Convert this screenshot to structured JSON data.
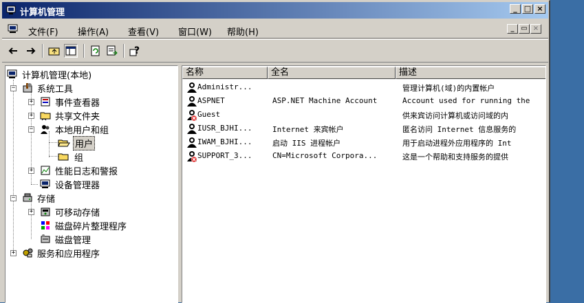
{
  "window": {
    "title": "计算机管理",
    "controls": [
      "_",
      "□",
      "×"
    ]
  },
  "menubar": {
    "items": [
      "文件(F)",
      "操作(A)",
      "查看(V)",
      "窗口(W)",
      "帮助(H)"
    ],
    "mdi_controls": [
      "_",
      "▭",
      "×"
    ]
  },
  "toolbar": {
    "buttons": [
      "back-icon",
      "forward-icon",
      "up-folder-icon",
      "show-tree-icon",
      "refresh-icon",
      "export-list-icon",
      "help-icon"
    ]
  },
  "tree": {
    "root": "计算机管理(本地)",
    "system_tools": "系统工具",
    "event_viewer": "事件查看器",
    "shared_folders": "共享文件夹",
    "local_users_groups": "本地用户和组",
    "users": "用户",
    "groups": "组",
    "perf_logs": "性能日志和警报",
    "device_manager": "设备管理器",
    "storage": "存储",
    "removable_storage": "可移动存储",
    "defrag": "磁盘碎片整理程序",
    "disk_mgmt": "磁盘管理",
    "services_apps": "服务和应用程序"
  },
  "list": {
    "columns": [
      "名称",
      "全名",
      "描述"
    ],
    "rows": [
      {
        "name": "Administr...",
        "full": "",
        "desc": "管理计算机(域)的内置帐户",
        "disabled": false
      },
      {
        "name": "ASPNET",
        "full": "ASP.NET Machine Account",
        "desc": "Account used for running the",
        "disabled": false
      },
      {
        "name": "Guest",
        "full": "",
        "desc": "供来宾访问计算机或访问域的内",
        "disabled": true
      },
      {
        "name": "IUSR_BJHI...",
        "full": "Internet 来宾帐户",
        "desc": "匿名访问 Internet 信息服务的",
        "disabled": false
      },
      {
        "name": "IWAM_BJHI...",
        "full": "启动 IIS 进程帐户",
        "desc": "用于启动进程外应用程序的 Int",
        "disabled": false
      },
      {
        "name": "SUPPORT_3...",
        "full": "CN=Microsoft Corpora...",
        "desc": "这是一个帮助和支持服务的提供",
        "disabled": true
      }
    ]
  }
}
